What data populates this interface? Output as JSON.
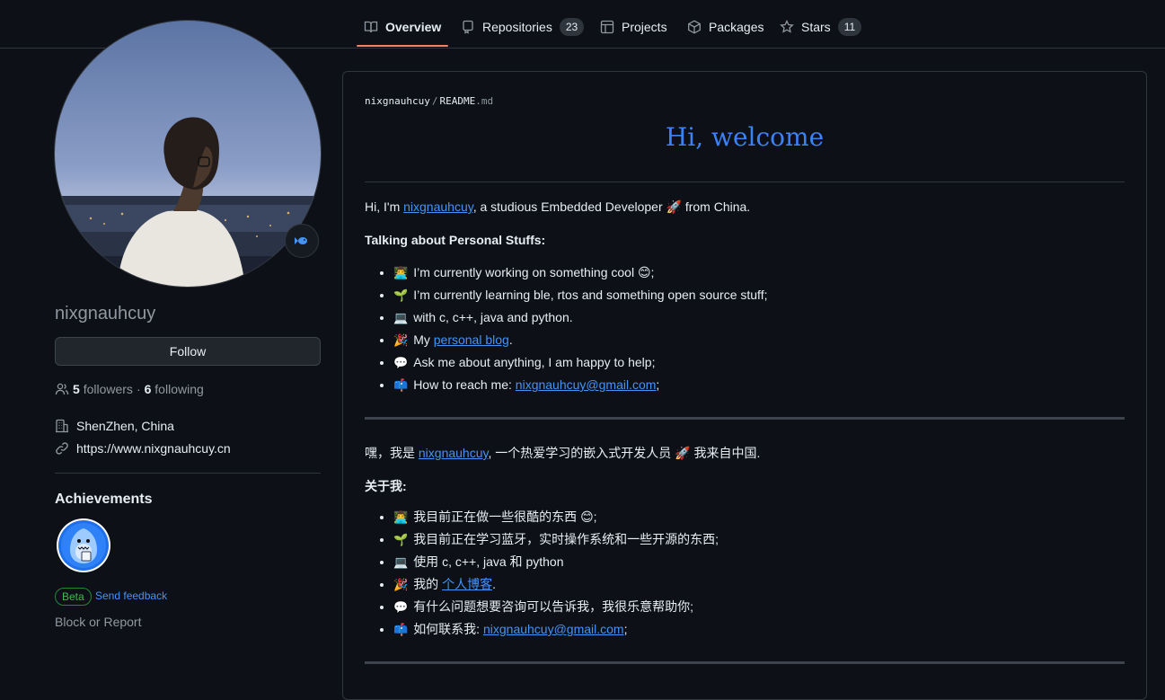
{
  "nav": {
    "tabs": [
      {
        "label": "Overview",
        "icon": "book-icon",
        "active": true
      },
      {
        "label": "Repositories",
        "icon": "repo-icon",
        "count": "23"
      },
      {
        "label": "Projects",
        "icon": "table-icon"
      },
      {
        "label": "Packages",
        "icon": "package-icon"
      },
      {
        "label": "Stars",
        "icon": "star-icon",
        "count": "11"
      }
    ]
  },
  "profile": {
    "username": "nixgnauhcuy",
    "follow_label": "Follow",
    "followers_count": "5",
    "followers_label": "followers",
    "dot": "·",
    "following_count": "6",
    "following_label": "following",
    "location": "ShenZhen, China",
    "website": "https://www.nixgnauhcuy.cn",
    "status_icon": "fish-icon"
  },
  "achievements": {
    "title": "Achievements",
    "badge_icon": "shark-badge-icon",
    "beta_label": "Beta",
    "feedback_label": "Send feedback"
  },
  "block_label": "Block or Report",
  "readme": {
    "owner": "nixgnauhcuy",
    "sep": "/",
    "file": "README",
    "ext": ".md",
    "title": "Hi, welcome",
    "en": {
      "intro_pre": "Hi, I'm ",
      "intro_link": "nixgnauhcuy",
      "intro_post": ", a studious Embedded Developer 🚀 from China.",
      "heading": "Talking about Personal Stuffs:",
      "items": [
        {
          "emoji": "👨‍💻",
          "text": "I’m currently working on something cool 😊;"
        },
        {
          "emoji": "🌱",
          "text": "I’m currently learning ble, rtos and something open source stuff;"
        },
        {
          "emoji": "💻",
          "text": "with c, c++, java and python."
        },
        {
          "emoji": "🎉",
          "pre": "My ",
          "link": "personal blog",
          "post": "."
        },
        {
          "emoji": "💬",
          "text": "Ask me about anything, I am happy to help;"
        },
        {
          "emoji": "📫",
          "pre": "How to reach me: ",
          "link": "nixgnauhcuy@gmail.com",
          "post": ";"
        }
      ]
    },
    "zh": {
      "intro_pre": "嘿，我是 ",
      "intro_link": "nixgnauhcuy",
      "intro_post": ", 一个热爱学习的嵌入式开发人员 🚀 我来自中国.",
      "heading": "关于我:",
      "items": [
        {
          "emoji": "👨‍💻",
          "text": "我目前正在做一些很酷的东西 😊;"
        },
        {
          "emoji": "🌱",
          "text": "我目前正在学习蓝牙，实时操作系统和一些开源的东西;"
        },
        {
          "emoji": "💻",
          "text": "使用 c, c++, java 和 python"
        },
        {
          "emoji": "🎉",
          "pre": "我的 ",
          "link": "个人博客",
          "post": "."
        },
        {
          "emoji": "💬",
          "text": "有什么问题想要咨询可以告诉我，我很乐意帮助你;"
        },
        {
          "emoji": "📫",
          "pre": "如何联系我: ",
          "link": "nixgnauhcuy@gmail.com",
          "post": ";"
        }
      ]
    }
  },
  "colors": {
    "background": "#0d1117",
    "accent_tab": "#f78166",
    "link": "#4493f8",
    "title": "#3b82f6"
  }
}
